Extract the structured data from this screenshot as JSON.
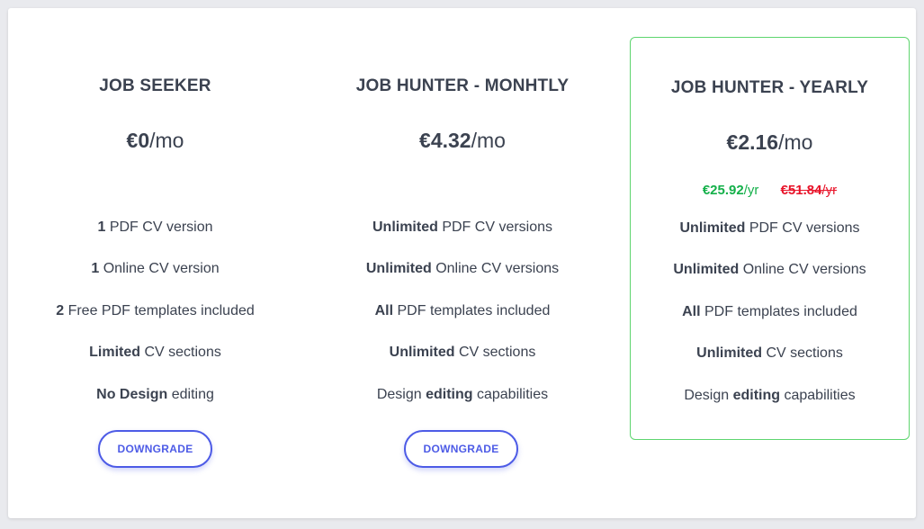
{
  "plans": [
    {
      "title": "JOB SEEKER",
      "price_amount": "€0",
      "price_unit": "/mo",
      "features": [
        {
          "bold": "1",
          "text": " PDF CV version"
        },
        {
          "bold": "1",
          "text": " Online CV version"
        },
        {
          "bold": "2",
          "text": " Free PDF templates included"
        },
        {
          "bold": "Limited",
          "text": " CV sections"
        },
        {
          "bold": "No Design",
          "text": " editing"
        }
      ],
      "button_label": "DOWNGRADE"
    },
    {
      "title": "JOB HUNTER - MONHTLY",
      "price_amount": "€4.32",
      "price_unit": "/mo",
      "features": [
        {
          "bold": "Unlimited",
          "text": " PDF CV versions"
        },
        {
          "bold": "Unlimited",
          "text": " Online CV versions"
        },
        {
          "bold": "All",
          "text": " PDF templates included"
        },
        {
          "bold": "Unlimited",
          "text": " CV sections"
        },
        {
          "pre": "Design ",
          "bold": "editing",
          "text": " capabilities"
        }
      ],
      "button_label": "DOWNGRADE"
    },
    {
      "title": "JOB HUNTER - YEARLY",
      "price_amount": "€2.16",
      "price_unit": "/mo",
      "yearly_price": "€25.92",
      "yearly_unit": "/yr",
      "yearly_old_price": "€51.84",
      "yearly_old_unit": "/yr",
      "features": [
        {
          "bold": "Unlimited",
          "text": " PDF CV versions"
        },
        {
          "bold": "Unlimited",
          "text": " Online CV versions"
        },
        {
          "bold": "All",
          "text": " PDF templates included"
        },
        {
          "bold": "Unlimited",
          "text": " CV sections"
        },
        {
          "pre": "Design ",
          "bold": "editing",
          "text": " capabilities"
        }
      ]
    }
  ],
  "colors": {
    "accent": "#4d5be6",
    "highlight_border": "#5ed56f",
    "discount_green": "#14b04a",
    "strike_red": "#e8142a"
  }
}
